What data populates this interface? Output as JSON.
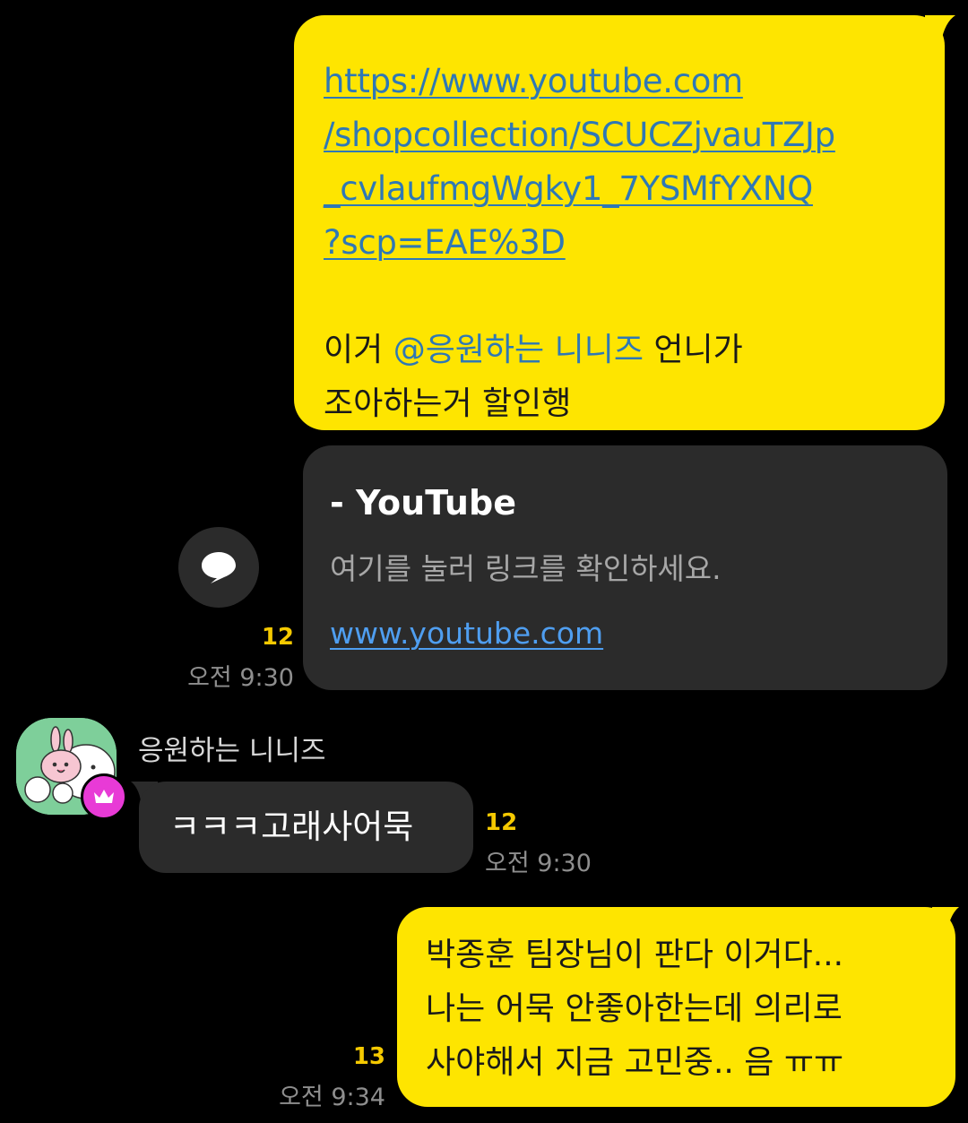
{
  "messages": {
    "msg1": {
      "link_lines": [
        "https://www.youtube.com",
        "/shopcollection/SCUCZjvauTZJp",
        "_cvlaufmgWgky1_7YSMfYXNQ",
        "?scp=EAE%3D"
      ],
      "text_before_mention": "이거 ",
      "mention": "@응원하는 니니즈",
      "text_after_mention": " 언니가",
      "text_line2": "조아하는거 할인행"
    },
    "link_preview": {
      "title": "- YouTube",
      "description": "여기를 눌러 링크를 확인하세요.",
      "domain": "www.youtube.com",
      "unread_count": "12",
      "time": "오전 9:30",
      "share_icon": "speech-bubble-icon"
    },
    "msg2": {
      "sender_name": "응원하는 니니즈",
      "text": "ㅋㅋㅋ고래사어묵",
      "unread_count": "12",
      "time": "오전 9:30",
      "badge_icon": "crown-icon"
    },
    "msg3": {
      "lines": [
        "박종훈 팀장님이 판다 이거다...",
        "나는 어묵 안좋아한는데 의리로",
        "사야해서 지금 고민중.. 음 ㅠㅠ"
      ],
      "unread_count": "13",
      "time": "오전 9:34"
    }
  },
  "colors": {
    "background": "#000000",
    "my_bubble": "#FEE500",
    "other_bubble": "#2B2B2B",
    "link": "#2F78B5",
    "unread": "#F5C900"
  }
}
